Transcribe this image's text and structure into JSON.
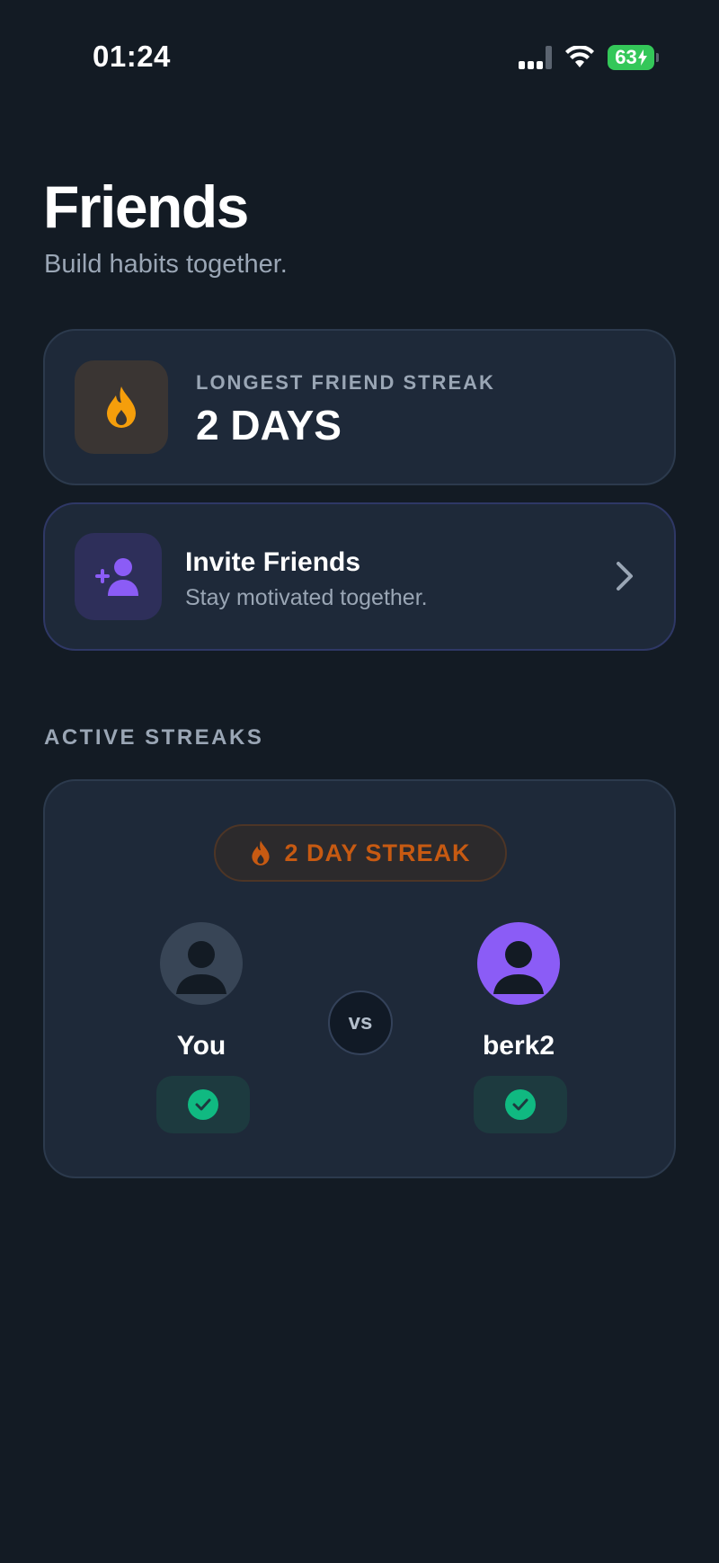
{
  "status_bar": {
    "time": "01:24",
    "battery": "63"
  },
  "header": {
    "title": "Friends",
    "subtitle": "Build habits together."
  },
  "longest_streak": {
    "label": "LONGEST FRIEND STREAK",
    "value": "2 DAYS",
    "icon": "flame-icon",
    "accent": "#f59e0b"
  },
  "invite": {
    "title": "Invite Friends",
    "subtitle": "Stay motivated together.",
    "icon": "add-user-icon",
    "accent": "#8b5cf6"
  },
  "active_streaks": {
    "section_label": "ACTIVE STREAKS",
    "items": [
      {
        "badge": "2 DAY STREAK",
        "vs_label": "vs",
        "players": [
          {
            "name": "You",
            "completed": true
          },
          {
            "name": "berk2",
            "completed": true
          }
        ]
      }
    ]
  },
  "colors": {
    "background": "#131b24",
    "card": "#1e2939",
    "streak_orange": "#c75a12",
    "check_green": "#10b981"
  }
}
